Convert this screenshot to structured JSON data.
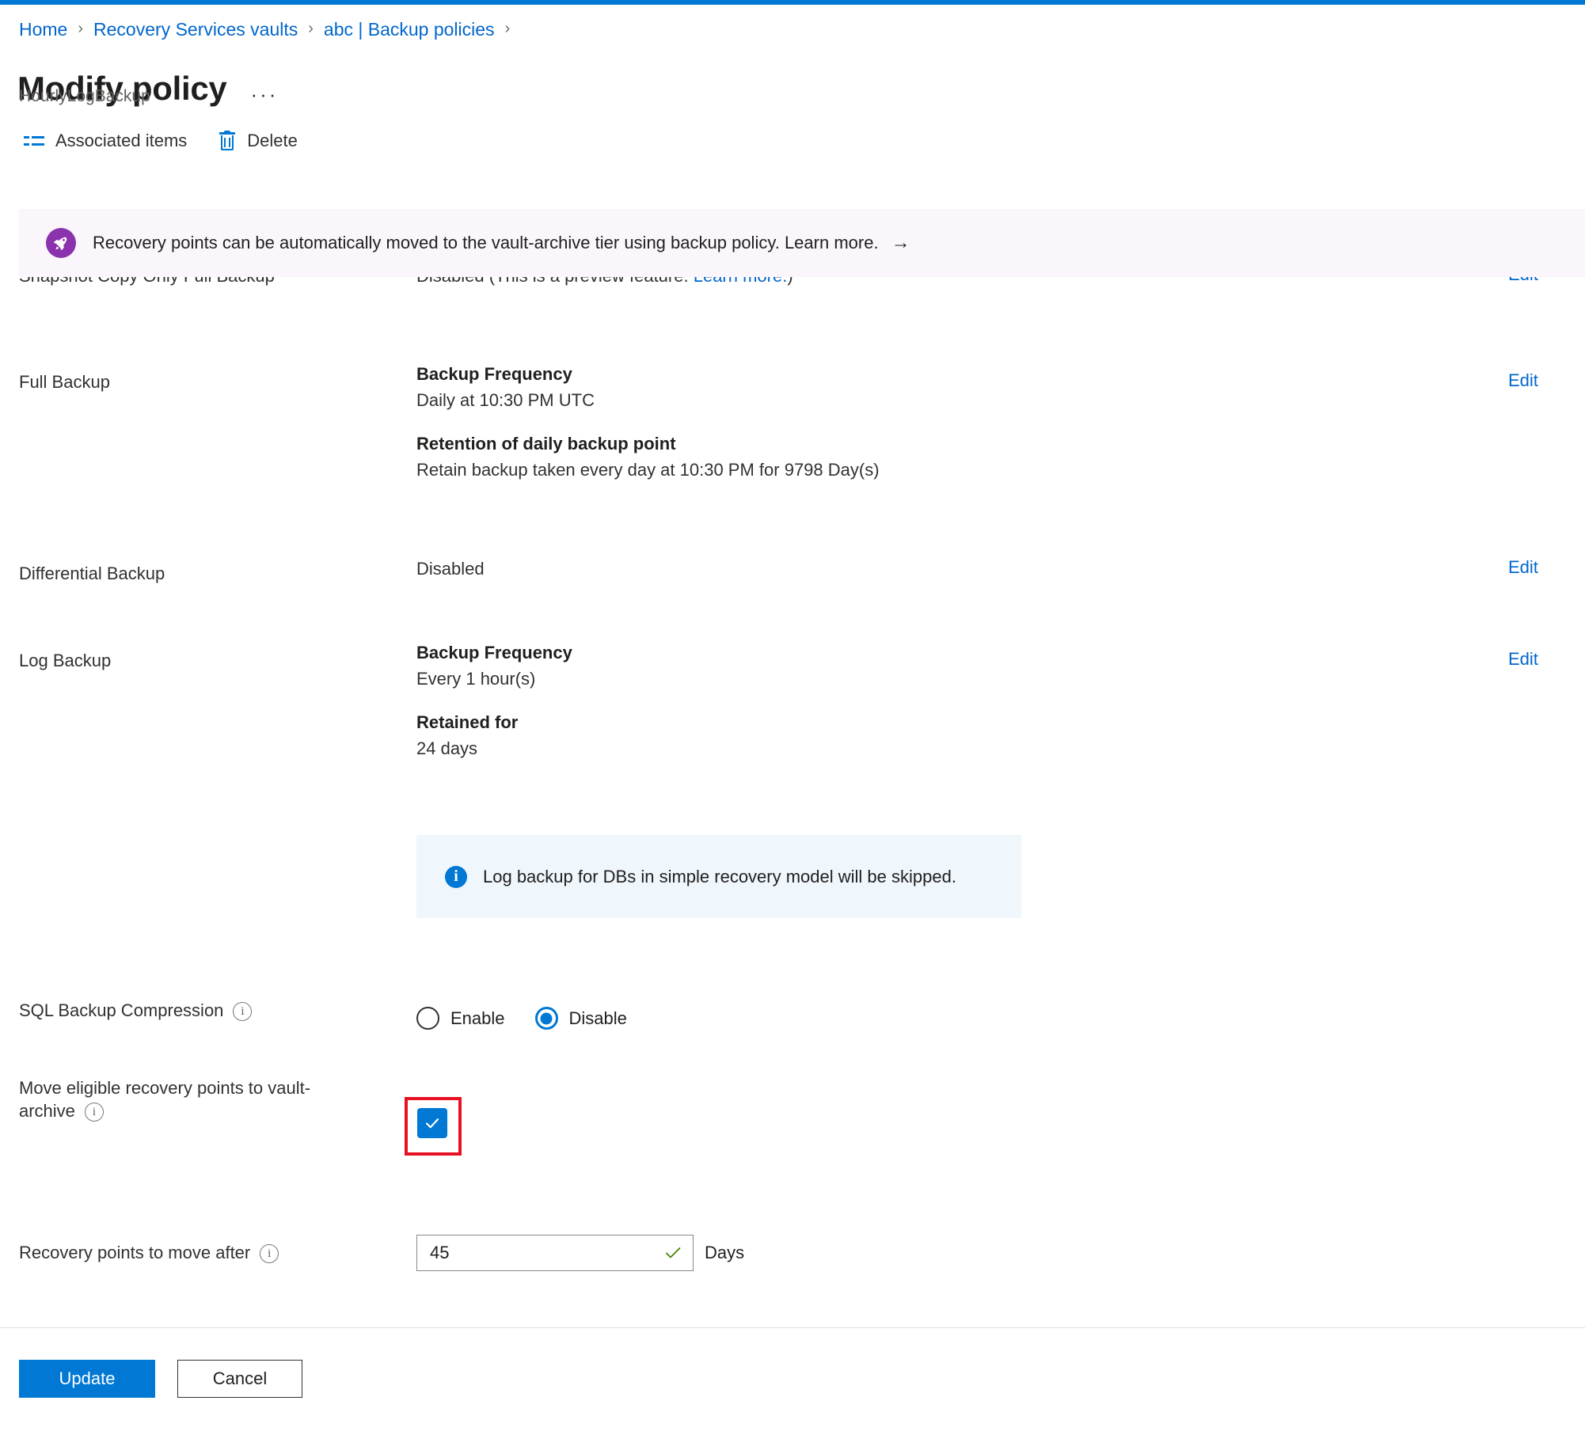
{
  "theme": {
    "accent": "#0078d4",
    "link": "#0066cc",
    "promo_bg": "#faf6fc",
    "promo_icon_bg": "#8b33ad",
    "info_bg": "#eff6fc",
    "highlight_red": "#e81123",
    "valid_green": "#498205"
  },
  "breadcrumb": {
    "items": [
      {
        "label": "Home"
      },
      {
        "label": "Recovery Services vaults"
      },
      {
        "label": "abc | Backup policies"
      }
    ],
    "separator": "›",
    "trailing_separator": "›"
  },
  "header": {
    "title": "Modify policy",
    "more_menu": "···",
    "subtitle": "HourlyLogBackup"
  },
  "commandbar": {
    "items": [
      {
        "label": "Associated items",
        "icon": "associated-items-icon"
      },
      {
        "label": "Delete",
        "icon": "trash-icon"
      }
    ]
  },
  "promo_banner": {
    "icon": "rocket-icon",
    "text": "Recovery points can be automatically moved to the vault-archive tier using backup policy.",
    "link_text": "Learn more.",
    "arrow": "→"
  },
  "sections": {
    "snapshot_copy_only_full_backup": {
      "label": "Snapshot Copy Only Full Backup",
      "value_prefix": "Disabled (This is a preview feature.",
      "value_link": "Learn more.",
      "value_suffix": ")",
      "edit_label": "Edit"
    },
    "full_backup": {
      "label": "Full Backup",
      "frequency_heading": "Backup Frequency",
      "frequency_value": "Daily at 10:30 PM UTC",
      "retention_heading": "Retention of daily backup point",
      "retention_value": "Retain backup taken every day at 10:30 PM for 9798 Day(s)",
      "edit_label": "Edit"
    },
    "differential_backup": {
      "label": "Differential Backup",
      "value": "Disabled",
      "edit_label": "Edit"
    },
    "log_backup": {
      "label": "Log Backup",
      "frequency_heading": "Backup Frequency",
      "frequency_value": "Every 1 hour(s)",
      "retained_heading": "Retained for",
      "retained_value": "24 days",
      "edit_label": "Edit",
      "info_note": "Log backup for DBs in simple recovery model will be skipped.",
      "info_icon": "info-icon"
    },
    "sql_backup_compression": {
      "label": "SQL Backup Compression",
      "info_icon": "info-circle-icon",
      "options": [
        {
          "label": "Enable",
          "selected": false
        },
        {
          "label": "Disable",
          "selected": true
        }
      ]
    },
    "move_to_vault_archive": {
      "label": "Move eligible recovery points to vault-archive",
      "info_icon": "info-circle-icon",
      "checked": true,
      "highlighted": true
    },
    "recovery_points_move_after": {
      "label": "Recovery points to move after",
      "info_icon": "info-circle-icon",
      "value": "45",
      "placeholder": "",
      "unit": "Days",
      "validation": "valid"
    }
  },
  "footer": {
    "update_label": "Update",
    "cancel_label": "Cancel"
  }
}
